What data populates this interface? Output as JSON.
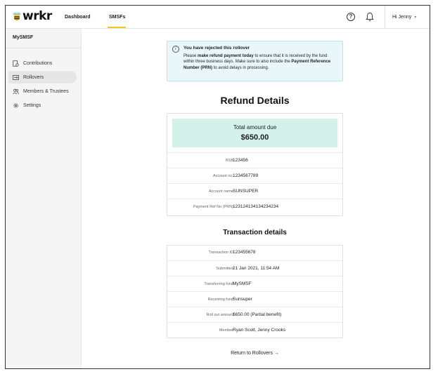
{
  "header": {
    "logo_text": "wrkr",
    "nav": [
      {
        "label": "Dashboard"
      },
      {
        "label": "SMSFs"
      }
    ],
    "help_glyph": "?",
    "user_greeting": "Hi Jenny",
    "icons": [
      "bee-logo-icon",
      "help-icon",
      "bell-icon",
      "chevron-down-icon"
    ],
    "accent_color": "#f5c518"
  },
  "sidebar": {
    "title": "MySMSF",
    "items": [
      {
        "label": "Contributions",
        "icon": "contributions-icon"
      },
      {
        "label": "Rollovers",
        "icon": "rollovers-icon",
        "active": true
      },
      {
        "label": "Members & Trustees",
        "icon": "members-icon"
      },
      {
        "label": "Settings",
        "icon": "gear-icon"
      }
    ]
  },
  "alert": {
    "icon": "info-icon",
    "icon_glyph": "i",
    "title": "You have rejected this rollover",
    "text_1": "Please ",
    "bold_1": "make refund payment today",
    "text_2": " to ensure that it is received by the fund within three business days. Make sure to also include the ",
    "bold_2": "Payment Reference Number (PRN)",
    "text_3": " to avoid delays in processing.",
    "background": "#e9f7fb"
  },
  "refund": {
    "title": "Refund Details",
    "total_label": "Total amount due",
    "total_value": "$650.00",
    "total_background": "#d4f2ea",
    "rows": [
      {
        "label": "BSB",
        "value": "123456"
      },
      {
        "label": "Account no.",
        "value": "1234567789"
      },
      {
        "label": "Account name",
        "value": "SUNSUPER"
      },
      {
        "label": "Payment Ref No (PRN)",
        "value": "123124134134234234"
      }
    ]
  },
  "transaction": {
    "title": "Transaction details",
    "rows": [
      {
        "label": "Transaction ID",
        "value": "123455678"
      },
      {
        "label": "Submitted",
        "value": "21 Jan 2021, 11:54 AM"
      },
      {
        "label": "Transferring fund",
        "value": "MySMSF"
      },
      {
        "label": "Receiving fund",
        "value": "Sunsuper"
      },
      {
        "label": "Roll out amount",
        "value": "$650.00 (Partial benefit)"
      },
      {
        "label": "Member",
        "value": "Ryan Scott, Jenny Crooks"
      }
    ]
  },
  "return_link": "Return to Rollovers →"
}
